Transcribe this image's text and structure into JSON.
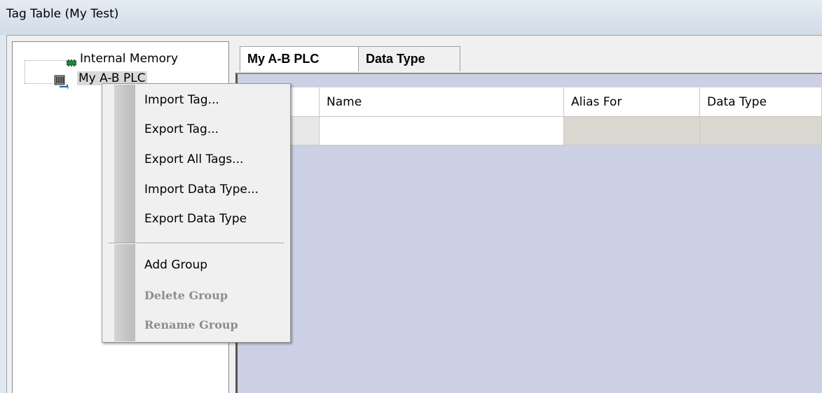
{
  "window": {
    "title": "Tag Table (My Test)"
  },
  "tree": {
    "items": [
      {
        "label": "Internal Memory",
        "icon": "memory-chip-icon"
      },
      {
        "label": "My A-B PLC",
        "icon": "plc-device-icon"
      }
    ]
  },
  "tabs": [
    {
      "label": "My A-B PLC",
      "active": true
    },
    {
      "label": "Data Type",
      "active": false
    }
  ],
  "grid": {
    "columns": [
      "Name",
      "Alias For",
      "Data Type"
    ],
    "rows": [
      {
        "name": "",
        "alias_for": "",
        "data_type": ""
      }
    ]
  },
  "context_menu": {
    "items": [
      {
        "label": "Import Tag...",
        "enabled": true
      },
      {
        "label": "Export Tag...",
        "enabled": true
      },
      {
        "label": "Export All Tags...",
        "enabled": true
      },
      {
        "label": "Import Data Type...",
        "enabled": true
      },
      {
        "label": "Export Data Type",
        "enabled": true
      },
      {
        "label": "Add Group",
        "enabled": true
      },
      {
        "label": "Delete Group",
        "enabled": false
      },
      {
        "label": "Rename Group",
        "enabled": false
      }
    ]
  },
  "colors": {
    "grid_background": "#ccd0e4",
    "menu_background": "#f0f0f0",
    "disabled_text": "#8d8d8d"
  }
}
